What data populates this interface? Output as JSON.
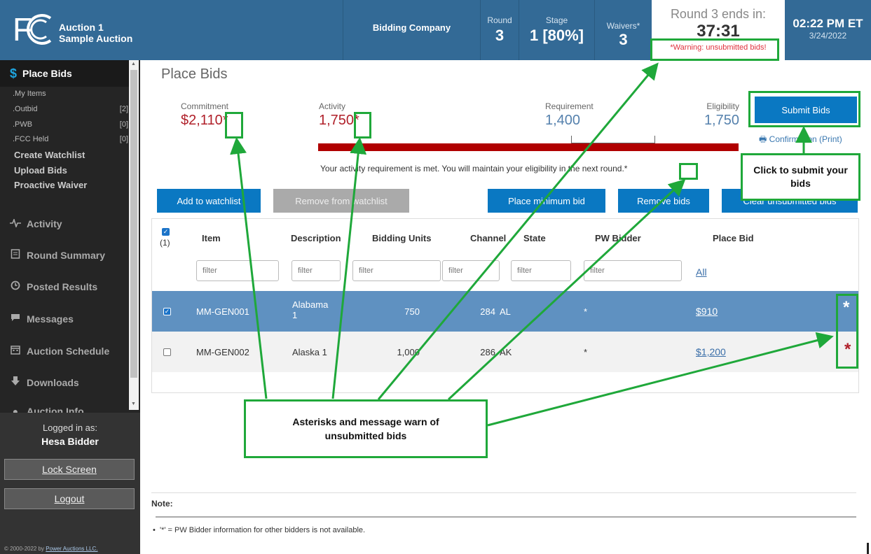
{
  "header": {
    "auction_line1": "Auction 1",
    "auction_line2": "Sample Auction",
    "company": "Bidding Company",
    "round_label": "Round",
    "round_value": "3",
    "stage_label": "Stage",
    "stage_value": "1 [80%]",
    "waivers_label": "Waivers*",
    "waivers_value": "3",
    "timer_label": "Round 3 ends in:",
    "timer_value": "37:31",
    "warning": "*Warning: unsubmitted bids!",
    "time": "02:22 PM ET",
    "date": "3/24/2022"
  },
  "sidebar": {
    "place_bids": "Place Bids",
    "sub_items": [
      {
        "label": ".My Items",
        "count": ""
      },
      {
        "label": ".Outbid",
        "count": "[2]"
      },
      {
        "label": ".PWB",
        "count": "[0]"
      },
      {
        "label": ".FCC Held",
        "count": "[0]"
      }
    ],
    "links": [
      "Create Watchlist",
      "Upload Bids",
      "Proactive Waiver"
    ],
    "nav": [
      "Activity",
      "Round Summary",
      "Posted Results",
      "Messages",
      "Auction Schedule",
      "Downloads",
      "Auction Info"
    ],
    "logged_in_label": "Logged in as:",
    "user_name": "Hesa Bidder",
    "lock_screen": "Lock Screen",
    "logout": "Logout",
    "copyright_prefix": "© 2000-2022 by ",
    "copyright_link": "Power Auctions LLC."
  },
  "main": {
    "title": "Place Bids",
    "commitment_label": "Commitment",
    "commitment_value": "$2,110*",
    "activity_label": "Activity",
    "activity_value": "1,750*",
    "requirement_label": "Requirement",
    "requirement_value": "1,400",
    "eligibility_label": "Eligibility",
    "eligibility_value": "1,750",
    "submit_label": "Submit Bids",
    "confirmation_label": "Confirmation",
    "print_label": "(Print)",
    "activity_message": "Your activity requirement is met. You will maintain your eligibility in the next round.*"
  },
  "buttons": {
    "add_watchlist": "Add to watchlist",
    "remove_watchlist": "Remove from watchlist",
    "place_min": "Place minimum bid",
    "remove_bids": "Remove bids",
    "clear_unsubmitted": "Clear unsubmitted bids"
  },
  "table": {
    "selected_count": "(1)",
    "headers": [
      "Item",
      "Description",
      "Bidding Units",
      "Channel",
      "State",
      "PW Bidder",
      "Place Bid"
    ],
    "filter_placeholder": "filter",
    "filter_all": "All",
    "rows": [
      {
        "item": "MM-GEN001",
        "description": "Alabama 1",
        "units": "750",
        "channel": "284",
        "state": "AL",
        "pw_bidder": "*",
        "bid": "$910",
        "flag": "*",
        "checked": true
      },
      {
        "item": "MM-GEN002",
        "description": "Alaska 1",
        "units": "1,000",
        "channel": "286",
        "state": "AK",
        "pw_bidder": "*",
        "bid": "$1,200",
        "flag": "*",
        "checked": false
      }
    ]
  },
  "note": {
    "title": "Note:",
    "text": "'*' = PW Bidder information for other bidders is not available."
  },
  "annotations": {
    "submit_callout": "Click to submit your bids",
    "asterisk_callout": "Asterisks and message warn of unsubmitted bids"
  },
  "colors": {
    "header_bg": "#336a96",
    "accent_button": "#0a78c2",
    "warning_red": "#b0202a",
    "annotation_green": "#1fa83a",
    "selected_row": "#5f91c1"
  }
}
